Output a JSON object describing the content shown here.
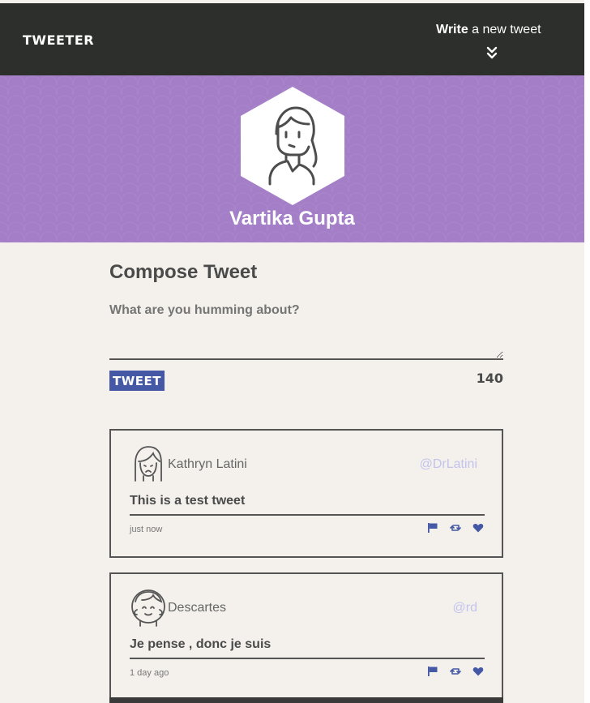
{
  "nav": {
    "brand": "TWEETER",
    "compose_bold": "Write",
    "compose_rest": " a new tweet",
    "chevron_icon": "double-chevron-down-icon"
  },
  "profile": {
    "name": "Vartika Gupta",
    "banner_color": "#a47fc8"
  },
  "composer": {
    "title": "Compose Tweet",
    "placeholder": "What are you humming about?",
    "button_label": "TWEET",
    "counter": "140",
    "accent": "#4458a5"
  },
  "tweets": [
    {
      "author": "Kathryn Latini",
      "handle": "@DrLatini",
      "content": "This is a test tweet",
      "timestamp": "just now"
    },
    {
      "author": "Descartes",
      "handle": "@rd",
      "content": "Je pense , donc je suis",
      "timestamp": "1 day ago"
    }
  ],
  "icons": {
    "flag": "flag-icon",
    "retweet": "retweet-icon",
    "like": "heart-icon"
  }
}
